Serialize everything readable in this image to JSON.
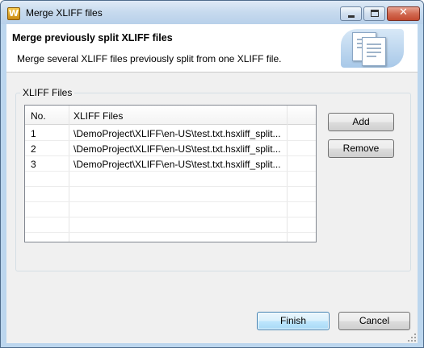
{
  "window": {
    "title": "Merge XLIFF files",
    "app_icon_letter": "W"
  },
  "header": {
    "title": "Merge previously split XLIFF files",
    "description": "Merge several XLIFF files previously split from one XLIFF file."
  },
  "group": {
    "label": "XLIFF Files"
  },
  "table": {
    "columns": [
      "No.",
      "XLIFF Files"
    ],
    "rows": [
      {
        "no": "1",
        "path": "\\DemoProject\\XLIFF\\en-US\\test.txt.hsxliff_split..."
      },
      {
        "no": "2",
        "path": "\\DemoProject\\XLIFF\\en-US\\test.txt.hsxliff_split..."
      },
      {
        "no": "3",
        "path": "\\DemoProject\\XLIFF\\en-US\\test.txt.hsxliff_split..."
      }
    ]
  },
  "buttons": {
    "add": "Add",
    "remove": "Remove",
    "finish": "Finish",
    "cancel": "Cancel",
    "close_glyph": "✕"
  }
}
